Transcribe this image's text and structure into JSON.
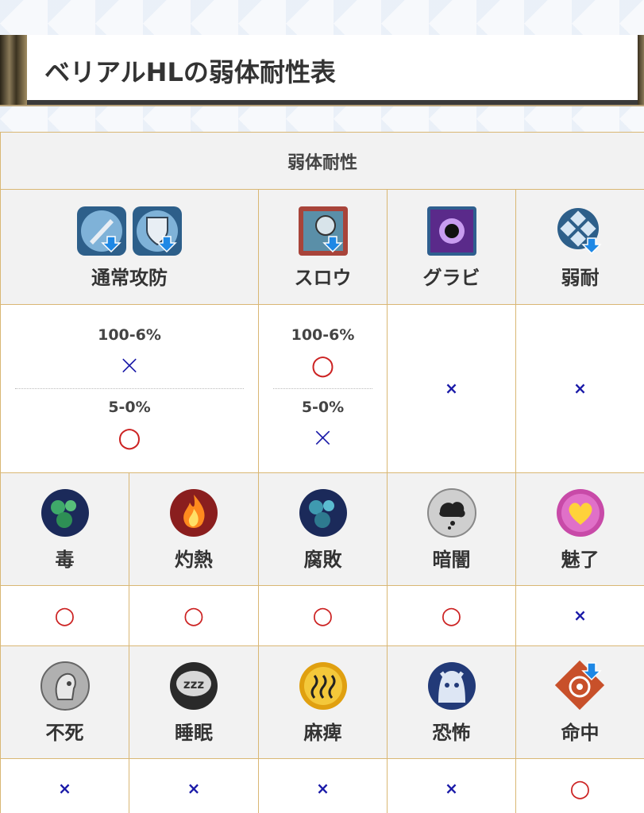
{
  "heading": {
    "title": "ベリアルHLの弱体耐性表"
  },
  "table": {
    "header": "弱体耐性",
    "row1": {
      "groups": [
        {
          "label": "通常攻防",
          "icons": [
            "attack-down-icon",
            "defense-down-icon"
          ]
        },
        {
          "label": "スロウ",
          "icons": [
            "slow-icon"
          ]
        },
        {
          "label": "グラビ",
          "icons": [
            "gravity-icon"
          ]
        },
        {
          "label": "弱耐",
          "icons": [
            "debuff-resistance-down-icon"
          ]
        }
      ],
      "values": {
        "normal": {
          "top_label": "100-6%",
          "top_mark": "×",
          "bottom_label": "5-0%",
          "bottom_mark": "○"
        },
        "slow": {
          "top_label": "100-6%",
          "top_mark": "○",
          "bottom_label": "5-0%",
          "bottom_mark": "×"
        },
        "gravity": "×",
        "weak_res": "×"
      }
    },
    "row2": {
      "items": [
        {
          "label": "毒",
          "icon": "poison-icon",
          "mark": "○"
        },
        {
          "label": "灼熱",
          "icon": "burn-icon",
          "mark": "○"
        },
        {
          "label": "腐敗",
          "icon": "putrefy-icon",
          "mark": "○"
        },
        {
          "label": "暗闇",
          "icon": "blind-icon",
          "mark": "○"
        },
        {
          "label": "魅了",
          "icon": "charm-icon",
          "mark": "×"
        }
      ]
    },
    "row3": {
      "items": [
        {
          "label": "不死",
          "icon": "undead-icon",
          "mark": "×"
        },
        {
          "label": "睡眠",
          "icon": "sleep-icon",
          "mark": "×"
        },
        {
          "label": "麻痺",
          "icon": "paralysis-icon",
          "mark": "×"
        },
        {
          "label": "恐怖",
          "icon": "fear-icon",
          "mark": "×"
        },
        {
          "label": "命中",
          "icon": "accuracy-down-icon",
          "mark": "○"
        }
      ]
    }
  },
  "colors": {
    "circle": "#cc2222",
    "cross": "#1a1aa8",
    "border": "#d9b774",
    "header_bg": "#f2f2f2"
  }
}
